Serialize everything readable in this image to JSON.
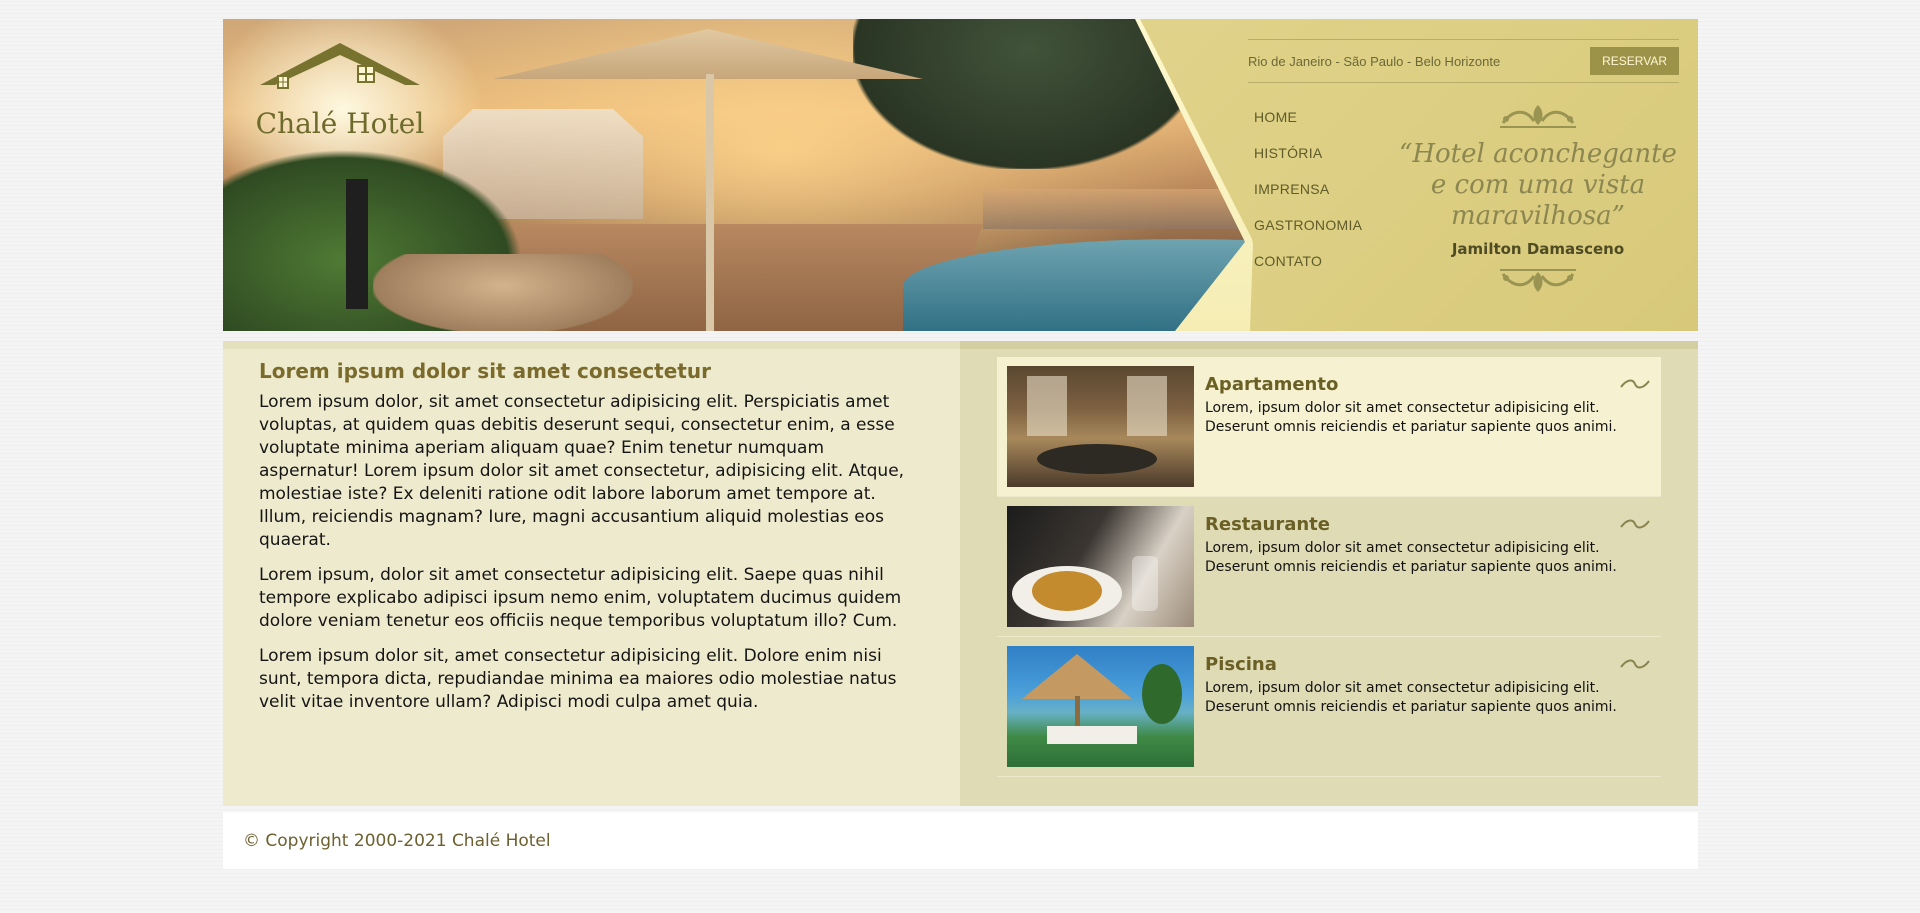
{
  "brand": {
    "logo_text": "Chalé Hotel"
  },
  "topbar": {
    "cities": "Rio de Janeiro - São Paulo - Belo Horizonte",
    "reserve_label": "RESERVAR"
  },
  "nav": {
    "items": [
      {
        "label": "HOME"
      },
      {
        "label": "HISTÓRIA"
      },
      {
        "label": "IMPRENSA"
      },
      {
        "label": "GASTRONOMIA"
      },
      {
        "label": "CONTATO"
      }
    ]
  },
  "quote": {
    "text": "“Hotel aconchegante e com uma vista maravilhosa”",
    "author": "Jamilton Damasceno"
  },
  "main": {
    "title": "Lorem ipsum dolor sit amet consectetur",
    "paragraphs": [
      "Lorem ipsum dolor, sit amet consectetur adipisicing elit. Perspiciatis amet voluptas, at quidem quas debitis deserunt sequi, consectetur enim, a esse voluptate minima aperiam aliquam quae? Enim tenetur numquam aspernatur! Lorem ipsum dolor sit amet consectetur, adipisicing elit. Atque, molestiae iste? Ex deleniti ratione odit labore laborum amet tempore at. Illum, reiciendis magnam? Iure, magni accusantium aliquid molestias eos quaerat.",
      "Lorem ipsum, dolor sit amet consectetur adipisicing elit. Saepe quas nihil tempore explicabo adipisci ipsum nemo enim, voluptatem ducimus quidem dolore veniam tenetur eos officiis neque temporibus voluptatum illo? Cum.",
      "Lorem ipsum dolor sit, amet consectetur adipisicing elit. Dolore enim nisi sunt, tempora dicta, repudiandae minima ea maiores odio molestiae natus velit vitae inventore ullam? Adipisci modi culpa amet quia."
    ]
  },
  "services": [
    {
      "title": "Apartamento",
      "text": "Lorem, ipsum dolor sit amet consectetur adipisicing elit. Deserunt omnis reiciendis et pariatur sapiente quos animi.",
      "icon": "swirl-icon"
    },
    {
      "title": "Restaurante",
      "text": "Lorem, ipsum dolor sit amet consectetur adipisicing elit. Deserunt omnis reiciendis et pariatur sapiente quos animi.",
      "icon": "swirl-icon"
    },
    {
      "title": "Piscina",
      "text": "Lorem, ipsum dolor sit amet consectetur adipisicing elit. Deserunt omnis reiciendis et pariatur sapiente quos animi.",
      "icon": "swirl-icon"
    }
  ],
  "footer": {
    "copyright": "© Copyright 2000-2021 Chalé Hotel"
  },
  "colors": {
    "accent": "#9c9349",
    "panel": "#ded07f",
    "content_bg": "#eeeacd",
    "aside_bg": "#dfdbb5",
    "title": "#7a6b2c"
  }
}
